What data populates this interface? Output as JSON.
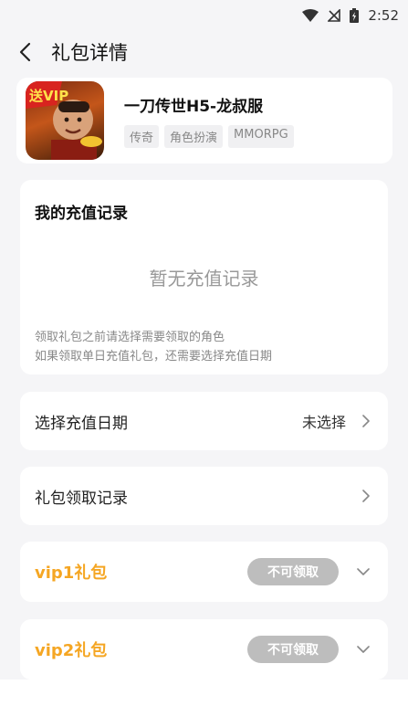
{
  "status_bar": {
    "time": "2:52"
  },
  "nav": {
    "title": "礼包详情"
  },
  "game": {
    "name": "一刀传世H5-龙叔服",
    "tags": [
      "传奇",
      "角色扮演",
      "MMORPG"
    ],
    "icon_badge": "送VIP"
  },
  "recharge_record": {
    "title": "我的充值记录",
    "empty_text": "暂无充值记录",
    "note_1": "领取礼包之前请选择需要领取的角色",
    "note_2": "如果领取单日充值礼包，还需要选择充值日期"
  },
  "select_date": {
    "label": "选择充值日期",
    "value": "未选择"
  },
  "claim_record": {
    "label": "礼包领取记录"
  },
  "packs": [
    {
      "name": "vip1礼包",
      "status": "不可领取"
    },
    {
      "name": "vip2礼包",
      "status": "不可领取"
    }
  ],
  "colors": {
    "accent": "#f5a623",
    "disabled": "#bdbdbd"
  }
}
